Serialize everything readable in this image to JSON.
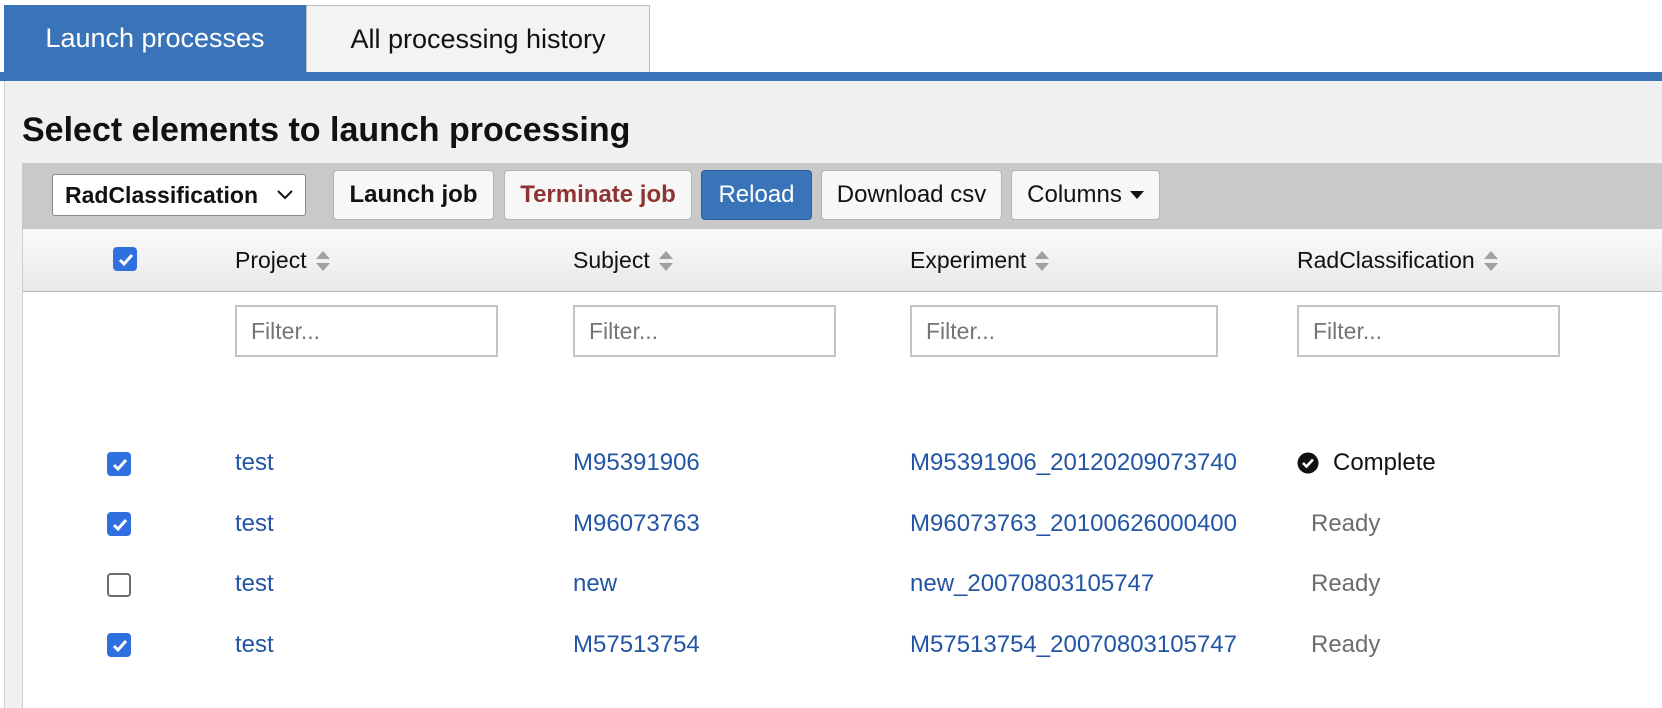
{
  "tabs": [
    {
      "label": "Launch processes",
      "active": true
    },
    {
      "label": "All processing history",
      "active": false
    }
  ],
  "panel": {
    "title": "Select elements to launch processing"
  },
  "toolbar": {
    "pipeline_select": "RadClassification",
    "launch_label": "Launch job",
    "terminate_label": "Terminate job",
    "reload_label": "Reload",
    "download_label": "Download csv",
    "columns_label": "Columns"
  },
  "table": {
    "select_all_checked": true,
    "columns": [
      "Project",
      "Subject",
      "Experiment",
      "RadClassification"
    ],
    "filter_placeholder": "Filter...",
    "rows": [
      {
        "checked": true,
        "project": "test",
        "subject": "M95391906",
        "experiment": "M95391906_20120209073740",
        "status": "Complete"
      },
      {
        "checked": true,
        "project": "test",
        "subject": "M96073763",
        "experiment": "M96073763_20100626000400",
        "status": "Ready"
      },
      {
        "checked": false,
        "project": "test",
        "subject": "new",
        "experiment": "new_20070803105747",
        "status": "Ready"
      },
      {
        "checked": true,
        "project": "test",
        "subject": "M57513754",
        "experiment": "M57513754_20070803105747",
        "status": "Ready"
      }
    ]
  },
  "colors": {
    "accent": "#3a74b8",
    "link": "#2255a4",
    "danger": "#8f3434",
    "checkbox": "#2f6fe0"
  }
}
